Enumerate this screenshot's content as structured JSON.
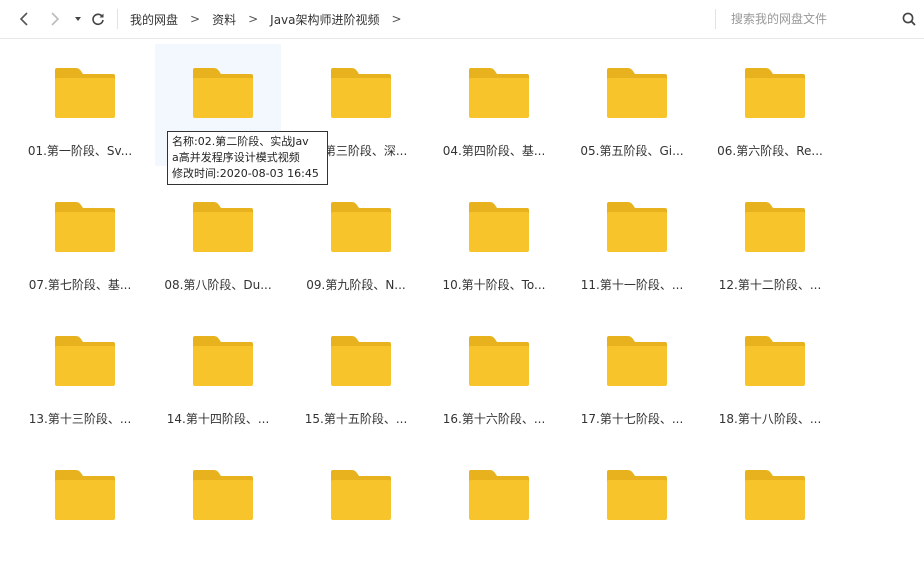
{
  "toolbar": {
    "breadcrumb": [
      "我的网盘",
      "资料",
      "Java架构师进阶视频"
    ],
    "search_placeholder": "搜索我的网盘文件"
  },
  "icons": {
    "back": "chevron-left-icon",
    "forward": "chevron-right-icon",
    "history": "caret-down-icon",
    "refresh": "refresh-icon",
    "search": "search-icon",
    "folder": "folder-icon"
  },
  "colors": {
    "folder": "#f7c52b",
    "folder_tab": "#e8b11e",
    "hover": "#f2f8fe"
  },
  "folders": [
    {
      "name": "01.第一阶段、Sv..."
    },
    {
      "name": "02.第二阶段、实战Java高并发程序设计模式视频",
      "label": ""
    },
    {
      "name": "03.第三阶段、深..."
    },
    {
      "name": "04.第四阶段、基..."
    },
    {
      "name": "05.第五阶段、Gi..."
    },
    {
      "name": "06.第六阶段、Re..."
    },
    {
      "name": "07.第七阶段、基..."
    },
    {
      "name": "08.第八阶段、Du..."
    },
    {
      "name": "09.第九阶段、N..."
    },
    {
      "name": "10.第十阶段、To..."
    },
    {
      "name": "11.第十一阶段、..."
    },
    {
      "name": "12.第十二阶段、..."
    },
    {
      "name": "13.第十三阶段、..."
    },
    {
      "name": "14.第十四阶段、..."
    },
    {
      "name": "15.第十五阶段、..."
    },
    {
      "name": "16.第十六阶段、..."
    },
    {
      "name": "17.第十七阶段、..."
    },
    {
      "name": "18.第十八阶段、..."
    },
    {
      "name": ""
    },
    {
      "name": ""
    },
    {
      "name": ""
    },
    {
      "name": ""
    },
    {
      "name": ""
    },
    {
      "name": ""
    }
  ],
  "tooltip": {
    "line1": "名称:02.第二阶段、实战Jav",
    "line2": "a高并发程序设计模式视频",
    "line3": "修改时间:2020-08-03 16:45"
  }
}
